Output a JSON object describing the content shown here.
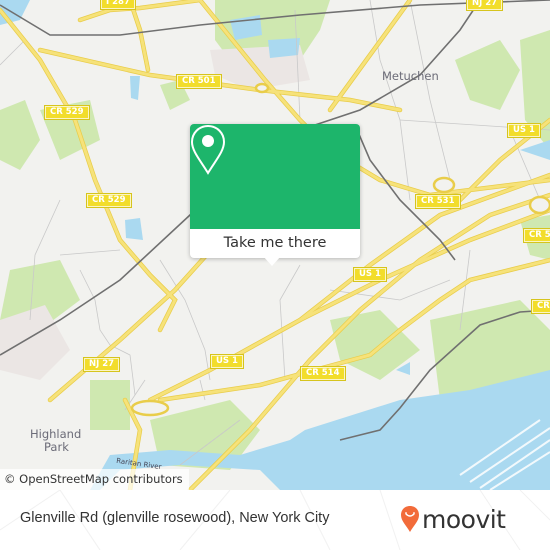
{
  "map": {
    "place_labels": [
      "Metuchen",
      "Highland",
      "Park"
    ],
    "water_label": "Raritan River",
    "road_shields": [
      {
        "id": "i287",
        "label": "I 287"
      },
      {
        "id": "nj27-top",
        "label": "NJ 27"
      },
      {
        "id": "cr501",
        "label": "CR 501"
      },
      {
        "id": "cr529-a",
        "label": "CR 529"
      },
      {
        "id": "cr529-b",
        "label": "CR 529"
      },
      {
        "id": "us1-ne",
        "label": "US 1"
      },
      {
        "id": "cr531",
        "label": "CR 531"
      },
      {
        "id": "cr5-east",
        "label": "CR 5"
      },
      {
        "id": "us1-mid",
        "label": "US 1"
      },
      {
        "id": "cr-east2",
        "label": "CR"
      },
      {
        "id": "nj27-sw",
        "label": "NJ 27"
      },
      {
        "id": "us1-sw",
        "label": "US 1"
      },
      {
        "id": "cr514",
        "label": "CR 514"
      }
    ],
    "attribution": "© OpenStreetMap contributors",
    "colors": {
      "land": "#f2f2ef",
      "park": "#c8e6a6",
      "water": "#aad9f0",
      "road_major": "#f6e27a",
      "rail": "#707070"
    }
  },
  "popup": {
    "icon": "map-pin-icon",
    "cta_label": "Take me there",
    "accent_color": "#1db56b"
  },
  "footer": {
    "title": "Glenville Rd (glenville rosewood), New York City",
    "brand_name": "moovit",
    "brand_icon": "moovit-pin-icon",
    "brand_color": "#f26b3a"
  }
}
